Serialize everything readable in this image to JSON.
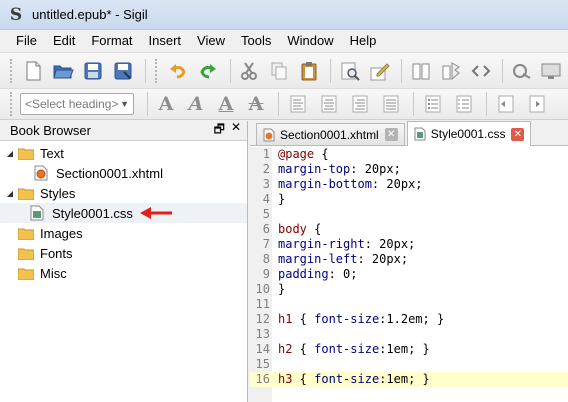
{
  "window": {
    "title": "untitled.epub* - Sigil"
  },
  "menu": [
    "File",
    "Edit",
    "Format",
    "Insert",
    "View",
    "Tools",
    "Window",
    "Help"
  ],
  "toolbar": {
    "heading_select": "<Select heading>",
    "format_buttons": [
      "A",
      "A",
      "A",
      "A"
    ]
  },
  "book_browser": {
    "title": "Book Browser",
    "float_glyph": "🗗",
    "close_glyph": "✕",
    "tree": [
      {
        "label": "Text",
        "type": "folder",
        "expanded": true,
        "depth": 0
      },
      {
        "label": "Section0001.xhtml",
        "type": "xhtml",
        "depth": 1
      },
      {
        "label": "Styles",
        "type": "folder",
        "expanded": true,
        "depth": 0
      },
      {
        "label": "Style0001.css",
        "type": "css",
        "depth": 1,
        "selected": true
      },
      {
        "label": "Images",
        "type": "folder",
        "depth": 0
      },
      {
        "label": "Fonts",
        "type": "folder",
        "depth": 0
      },
      {
        "label": "Misc",
        "type": "folder",
        "depth": 0
      }
    ]
  },
  "tabs": [
    {
      "label": "Section0001.xhtml",
      "active": false
    },
    {
      "label": "Style0001.css",
      "active": true
    }
  ],
  "code_lines": [
    {
      "n": "1",
      "parts": [
        [
          "sel",
          "@page"
        ],
        [
          "val",
          " {"
        ]
      ]
    },
    {
      "n": "2",
      "parts": [
        [
          "prop",
          "margin-top"
        ],
        [
          "val",
          ": 20px;"
        ]
      ]
    },
    {
      "n": "3",
      "parts": [
        [
          "prop",
          "margin-bottom"
        ],
        [
          "val",
          ": 20px;"
        ]
      ]
    },
    {
      "n": "4",
      "parts": [
        [
          "val",
          "}"
        ]
      ]
    },
    {
      "n": "5",
      "parts": []
    },
    {
      "n": "6",
      "parts": [
        [
          "sel",
          "body"
        ],
        [
          "val",
          " {"
        ]
      ]
    },
    {
      "n": "7",
      "parts": [
        [
          "prop",
          "margin-right"
        ],
        [
          "val",
          ": 20px;"
        ]
      ]
    },
    {
      "n": "8",
      "parts": [
        [
          "prop",
          "margin-left"
        ],
        [
          "val",
          ": 20px;"
        ]
      ]
    },
    {
      "n": "9",
      "parts": [
        [
          "prop",
          "padding"
        ],
        [
          "val",
          ": 0;"
        ]
      ]
    },
    {
      "n": "10",
      "parts": [
        [
          "val",
          "}"
        ]
      ]
    },
    {
      "n": "11",
      "parts": []
    },
    {
      "n": "12",
      "parts": [
        [
          "sel",
          "h1"
        ],
        [
          "val",
          " { "
        ],
        [
          "prop",
          "font-size"
        ],
        [
          "val",
          ":1.2em; }"
        ]
      ]
    },
    {
      "n": "13",
      "parts": []
    },
    {
      "n": "14",
      "parts": [
        [
          "sel",
          "h2"
        ],
        [
          "val",
          " { "
        ],
        [
          "prop",
          "font-size"
        ],
        [
          "val",
          ":1em; }"
        ]
      ]
    },
    {
      "n": "15",
      "parts": []
    },
    {
      "n": "16",
      "parts": [
        [
          "sel",
          "h3"
        ],
        [
          "val",
          " { "
        ],
        [
          "prop",
          "font-size"
        ],
        [
          "val",
          ":1em; }"
        ]
      ],
      "highlight": true
    }
  ],
  "colors": {
    "selector": "#800000",
    "property": "#000080",
    "current_line": "#ffffcc",
    "arrow": "#e0201a"
  }
}
